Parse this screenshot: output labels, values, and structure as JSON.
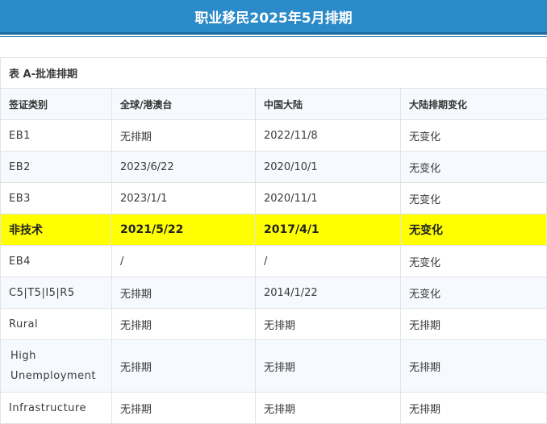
{
  "page": {
    "title": "职业移民2025年5月排期"
  },
  "table": {
    "caption": "表 A-批准排期",
    "headers": [
      "签证类别",
      "全球/港澳台",
      "中国大陆",
      "大陆排期变化"
    ],
    "rows": [
      [
        "EB1",
        "无排期",
        "2022/11/8",
        "无变化"
      ],
      [
        "EB2",
        "2023/6/22",
        "2020/10/1",
        "无变化"
      ],
      [
        "EB3",
        "2023/1/1",
        "2020/11/1",
        "无变化"
      ],
      [
        "非技术",
        "2021/5/22",
        "2017/4/1",
        "无变化"
      ],
      [
        "EB4",
        "/",
        "/",
        "无变化"
      ],
      [
        "C5|T5|I5|R5",
        "无排期",
        "2014/1/22",
        "无变化"
      ],
      [
        "Rural",
        "无排期",
        "无排期",
        "无排期"
      ],
      [
        " High Unemployment",
        "无排期",
        "无排期",
        "无排期"
      ],
      [
        "Infrastructure",
        "无排期",
        "无排期",
        "无排期"
      ]
    ],
    "highlight_color": "#ffff00"
  },
  "colors": {
    "banner": "#2b8ac8",
    "banner_border": "#1b6aa0"
  }
}
